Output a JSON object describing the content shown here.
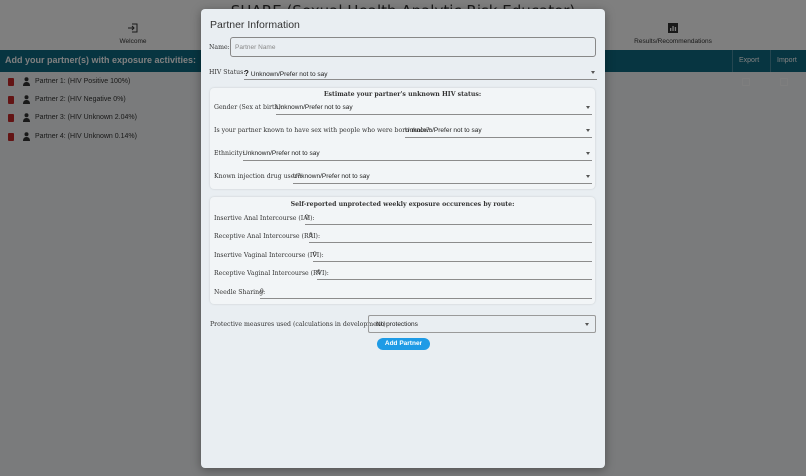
{
  "app": {
    "title": "SHARE (Sexual Health Analytic Risk Educator)",
    "nav": {
      "welcome": "Welcome",
      "results": "Results/Recommendations"
    }
  },
  "activity_bar": {
    "title": "Add your partner(s) with exposure activities:",
    "export_label": "Export",
    "import_label": "Import"
  },
  "partners": [
    {
      "label": "Partner 1:  (HIV Positive 100%)"
    },
    {
      "label": "Partner 2:  (HIV Negative 0%)"
    },
    {
      "label": "Partner 3:  (HIV Unknown 2.04%)"
    },
    {
      "label": "Partner 4:  (HIV Unknown 0.14%)"
    }
  ],
  "modal": {
    "title": "Partner Information",
    "name_label": "Name:",
    "name_placeholder": "Partner Name",
    "name_value": "",
    "hiv_label": "HIV Status:",
    "hiv_value": "Unknown/Prefer not to say",
    "estimate": {
      "title": "Estimate your partner's unknown HIV status:",
      "gender_label": "Gender (Sex at birth):",
      "gender_value": "Unknown/Prefer not to say",
      "msm_label": "Is your partner known to have sex with people who were born male?:",
      "msm_value": "Unknown/Prefer not to say",
      "ethnicity_label": "Ethnicity:",
      "ethnicity_value": "Unknown/Prefer not to say",
      "idu_label": "Known injection drug user?:",
      "idu_value": "Unknown/Prefer not to say"
    },
    "exposure": {
      "title": "Self-reported unprotected weekly exposure occurences by route:",
      "iai_label": "Insertive Anal Intercourse (IAI):",
      "iai_value": "0",
      "rai_label": "Receptive Anal Intercourse (RAI):",
      "rai_value": "0",
      "ivi_label": "Insertive Vaginal Intercourse (IVI):",
      "ivi_value": "0",
      "rvi_label": "Receptive Vaginal Intercourse (RVI):",
      "rvi_value": "0",
      "needle_label": "Needle Sharing:",
      "needle_value": "0"
    },
    "protective_label": "Protective measures used (calculations in development):",
    "protective_value": "No protections",
    "add_button": "Add Partner"
  }
}
